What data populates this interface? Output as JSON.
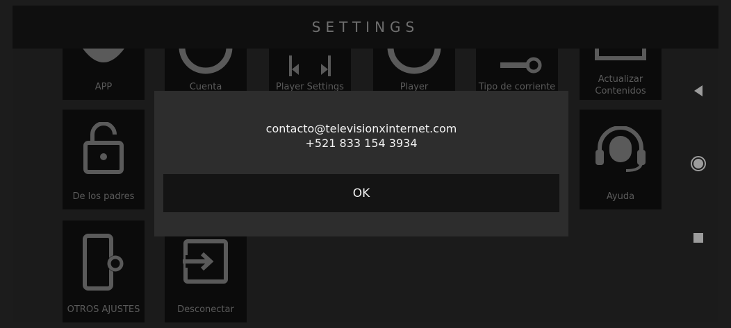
{
  "header": {
    "title": "SETTINGS"
  },
  "tiles": {
    "app": "APP",
    "cuenta": "Cuenta",
    "player_settings": "Player Settings",
    "player": "Player",
    "tipo_corriente": "Tipo de corriente",
    "actualizar": "Actualizar\nContenidos",
    "padres": "De los padres",
    "ayuda": "Ayuda",
    "otros": "OTROS AJUSTES",
    "desconectar": "Desconectar"
  },
  "dialog": {
    "email": "contacto@televisionxinternet.com",
    "phone": "+521 833 154 3934",
    "ok_label": "OK"
  },
  "icons": {
    "nav_back": "back-triangle-icon",
    "nav_home": "home-circle-icon",
    "nav_recents": "recents-square-icon"
  },
  "colors": {
    "background": "#2a2a2a",
    "tile": "#121212",
    "dialog": "#2d2d2d",
    "ok_button": "#141414"
  }
}
